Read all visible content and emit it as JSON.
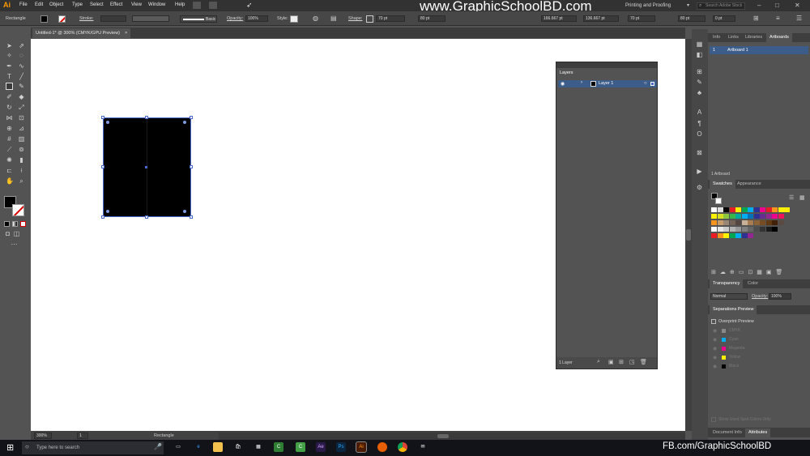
{
  "app": {
    "logo": "Ai",
    "watermark": "www.GraphicSchoolBD.com",
    "workspace": "Printing and Proofing",
    "search_placeholder": "Search Adobe Stock"
  },
  "menu": [
    "File",
    "Edit",
    "Object",
    "Type",
    "Select",
    "Effect",
    "View",
    "Window",
    "Help"
  ],
  "control": {
    "selection_label": "Rectangle",
    "stroke_label": "Stroke:",
    "stroke_style": "Basic",
    "opacity_label": "Opacity:",
    "opacity_value": "100%",
    "style_label": "Style:",
    "shape_label": "Shape:",
    "w_value": "70 pt",
    "h_value": "80 pt",
    "x_value": "166.667 pt",
    "y_value": "136.667 pt",
    "w2_value": "70 pt",
    "h2_value": "80 pt",
    "stroke_pt": "0 pt"
  },
  "document": {
    "tab_title": "Untitled-1* @ 300% (CMYK/GPU Preview)",
    "zoom": "300%",
    "status_tool": "Rectangle",
    "page": "1"
  },
  "layers_panel": {
    "title": "Layers",
    "layer_name": "Layer 1",
    "count": "1 Layer"
  },
  "artboards_panel": {
    "tabs": [
      "Info",
      "Links",
      "Libraries",
      "Artboards"
    ],
    "item_number": "1",
    "item_name": "Artboard 1",
    "count": "1 Artboard"
  },
  "swatches_panel": {
    "tabs": [
      "Swatches",
      "Appearance"
    ]
  },
  "transparency_panel": {
    "tabs": [
      "Transparency",
      "Color"
    ],
    "blend_mode": "Normal",
    "opacity_label": "Opacity:",
    "opacity_value": "100%"
  },
  "separations_panel": {
    "title": "Separations Preview",
    "overprint_label": "Overprint Preview",
    "inks": [
      "CMYK",
      "Cyan",
      "Magenta",
      "Yellow",
      "Black"
    ],
    "spot_label": "Show Used Spot Colors Only"
  },
  "bottom_tabs": [
    "Document Info",
    "Attributes"
  ],
  "taskbar": {
    "search_placeholder": "Type here to search",
    "fb_url": "FB.com/GraphicSchoolBD"
  },
  "colors": {
    "accent": "#4a68c8",
    "canvas": "#ffffff",
    "shape_fill": "#000000"
  }
}
